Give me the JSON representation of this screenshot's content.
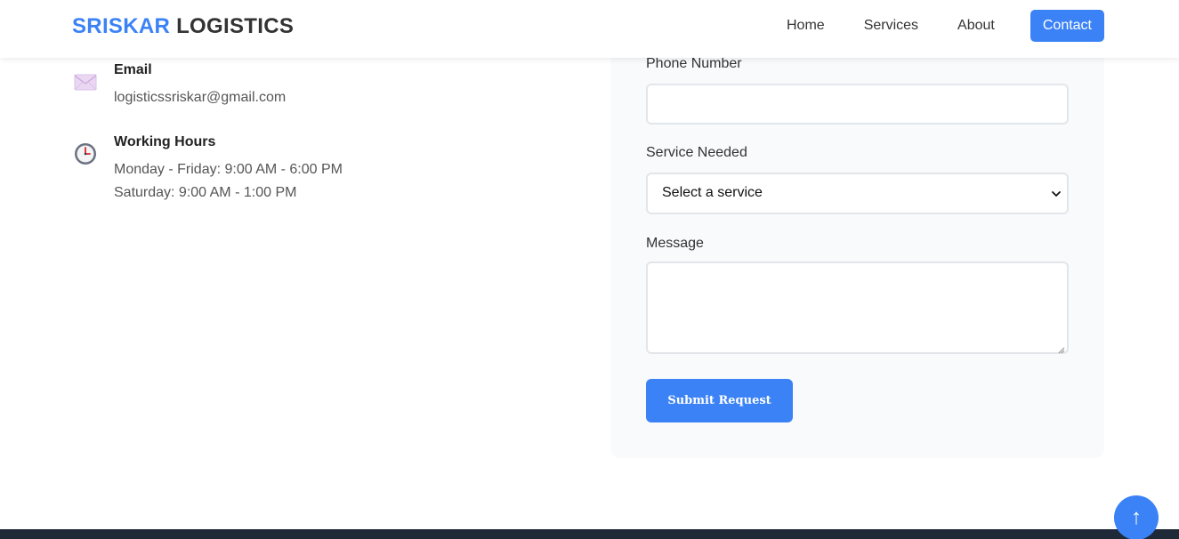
{
  "brand": {
    "accent": "SRISKAR",
    "rest": "LOGISTICS"
  },
  "nav": {
    "items": [
      {
        "label": "Home"
      },
      {
        "label": "Services"
      },
      {
        "label": "About"
      },
      {
        "label": "Contact",
        "active": true
      }
    ]
  },
  "contact_info": {
    "email": {
      "title": "Email",
      "value": "logisticssriskar@gmail.com",
      "icon": "envelope-icon"
    },
    "hours": {
      "title": "Working Hours",
      "lines": [
        "Monday - Friday: 9:00 AM - 6:00 PM",
        "Saturday: 9:00 AM - 1:00 PM"
      ],
      "icon": "clock-icon"
    }
  },
  "form": {
    "phone_label": "Phone Number",
    "phone_value": "",
    "service_label": "Service Needed",
    "service_selected": "Select a service",
    "message_label": "Message",
    "message_value": "",
    "submit_label": "Submit Request"
  },
  "scroll_top": {
    "glyph": "↑"
  },
  "colors": {
    "accent": "#3b82f6",
    "footer": "#1f2937",
    "card": "#f8fafc"
  }
}
